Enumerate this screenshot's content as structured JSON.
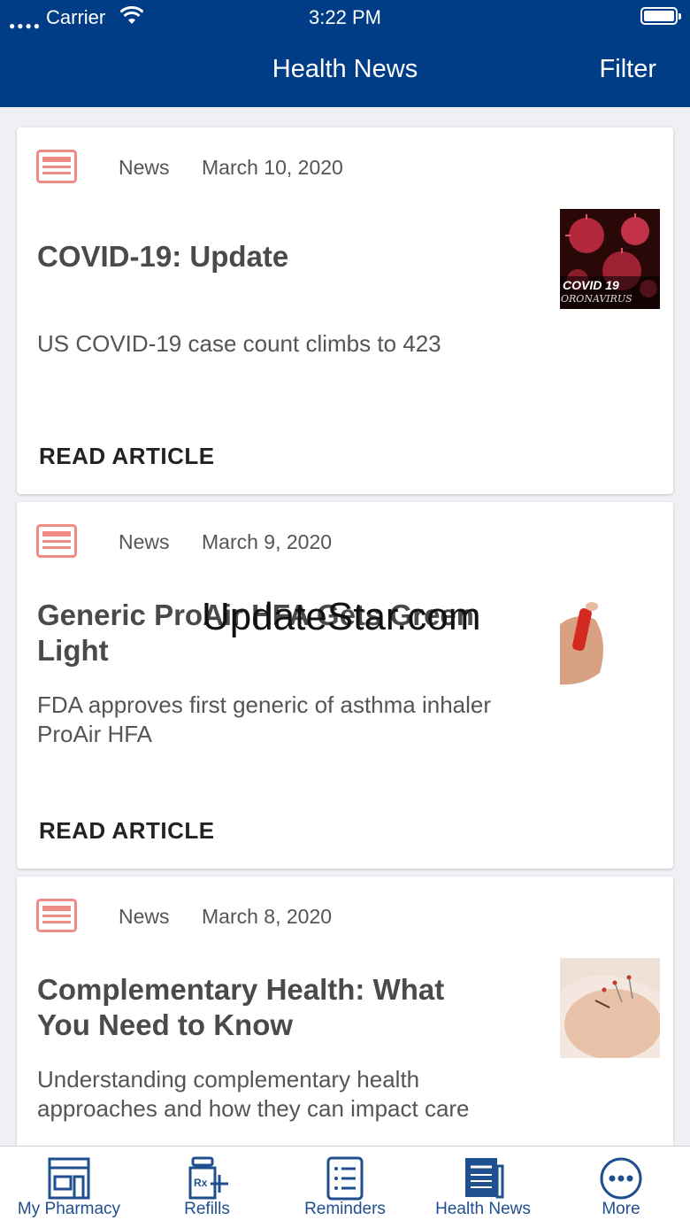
{
  "status_bar": {
    "carrier": "Carrier",
    "time": "3:22 PM"
  },
  "nav": {
    "title": "Health News",
    "filter_label": "Filter"
  },
  "watermark": "UpdateStar.com",
  "articles": [
    {
      "category": "News",
      "date": "March 10, 2020",
      "title": "COVID-19: Update",
      "description": "US COVID-19 case count climbs to 423",
      "read_label": "READ ARTICLE",
      "thumb_text_1": "COVID 19",
      "thumb_text_2": "ORONAVIRUS"
    },
    {
      "category": "News",
      "date": "March 9, 2020",
      "title": "Generic ProAir HFA Gets Green Light",
      "description": "FDA approves first generic of asthma inhaler ProAir HFA",
      "read_label": "READ ARTICLE"
    },
    {
      "category": "News",
      "date": "March 8, 2020",
      "title": "Complementary Health: What You Need to Know",
      "description": "Understanding complementary health approaches and how they can impact care"
    }
  ],
  "tabbar": {
    "items": [
      {
        "label": "My Pharmacy",
        "icon": "pharmacy-icon"
      },
      {
        "label": "Refills",
        "icon": "rx-refill-icon"
      },
      {
        "label": "Reminders",
        "icon": "checklist-icon"
      },
      {
        "label": "Health News",
        "icon": "newspaper-icon",
        "active": true
      },
      {
        "label": "More",
        "icon": "more-icon"
      }
    ]
  },
  "colors": {
    "header": "#003d86",
    "tab_tint": "#1f4f8f",
    "news_icon": "#f08b86"
  }
}
